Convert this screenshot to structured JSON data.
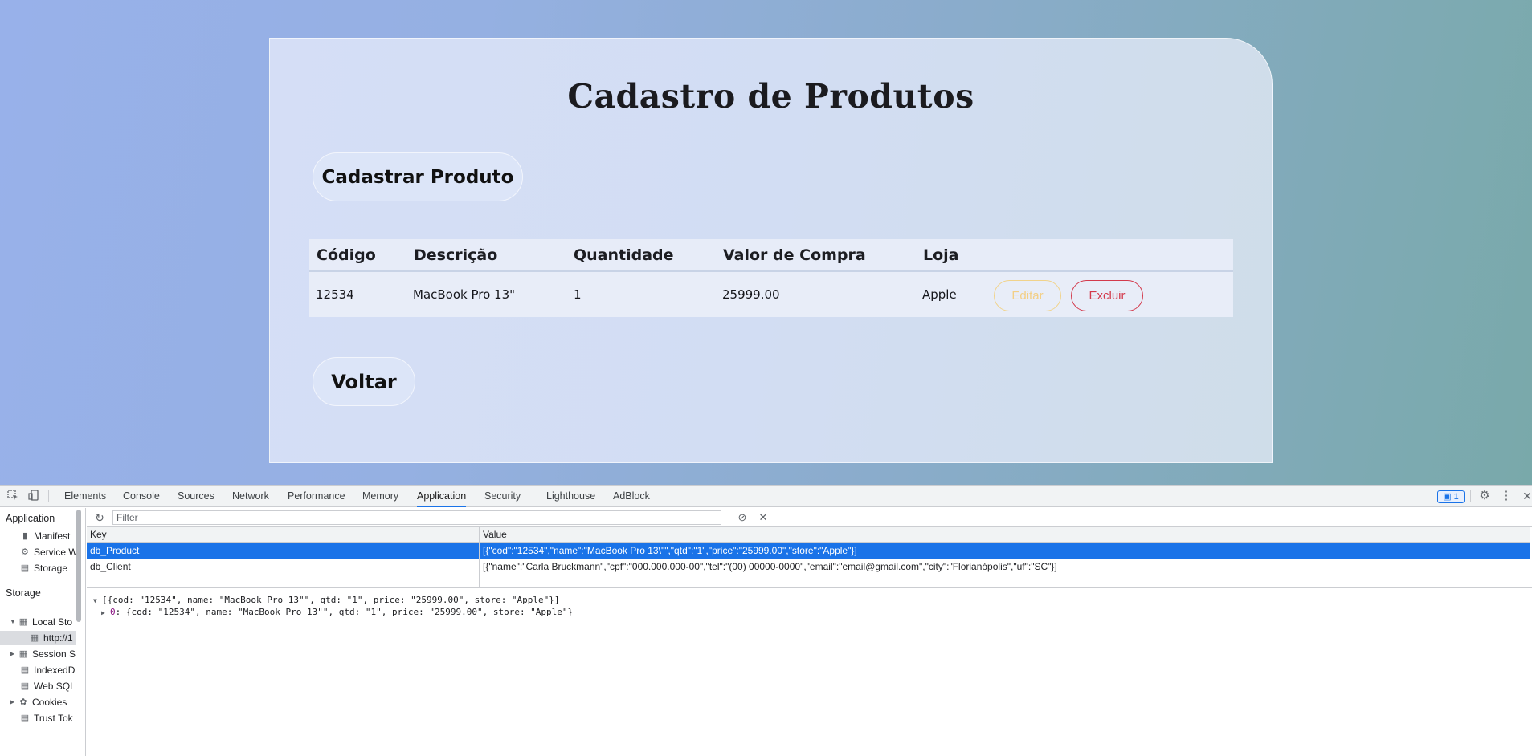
{
  "page": {
    "title": "Cadastro de Produtos",
    "add_button": "Cadastrar Produto",
    "back_button": "Voltar",
    "table": {
      "headers": [
        "Código",
        "Descrição",
        "Quantidade",
        "Valor de Compra",
        "Loja"
      ],
      "rows": [
        {
          "code": "12534",
          "description": "MacBook Pro 13\"",
          "quantity": "1",
          "price": "25999.00",
          "store": "Apple",
          "edit_label": "Editar",
          "delete_label": "Excluir"
        }
      ]
    }
  },
  "devtools": {
    "tabs": [
      "Elements",
      "Console",
      "Sources",
      "Network",
      "Performance",
      "Memory",
      "Application",
      "Security",
      "Lighthouse",
      "AdBlock"
    ],
    "active_tab": "Application",
    "issues_count": "1",
    "sidebar": {
      "application_header": "Application",
      "application_items": [
        "Manifest",
        "Service W",
        "Storage"
      ],
      "storage_header": "Storage",
      "storage_items": [
        "Local Sto",
        "http://1",
        "Session S",
        "IndexedD",
        "Web SQL",
        "Cookies",
        "Trust Tok"
      ]
    },
    "filter_placeholder": "Filter",
    "kv_headers": {
      "key": "Key",
      "value": "Value"
    },
    "kv_rows": [
      {
        "key": "db_Product",
        "value": "[{\"cod\":\"12534\",\"name\":\"MacBook Pro 13\\\"\",\"qtd\":\"1\",\"price\":\"25999.00\",\"store\":\"Apple\"}]"
      },
      {
        "key": "db_Client",
        "value": "[{\"name\":\"Carla Bruckmann\",\"cpf\":\"000.000.000-00\",\"tel\":\"(00) 00000-0000\",\"email\":\"email@gmail.com\",\"city\":\"Florianópolis\",\"uf\":\"SC\"}]"
      }
    ],
    "preview": {
      "line1": "[{cod: \"12534\", name: \"MacBook Pro 13\"\", qtd: \"1\", price: \"25999.00\", store: \"Apple\"}]",
      "line2_key": "0",
      "line2_value": ": {cod: \"12534\", name: \"MacBook Pro 13\"\", qtd: \"1\", price: \"25999.00\", store: \"Apple\"}"
    }
  }
}
